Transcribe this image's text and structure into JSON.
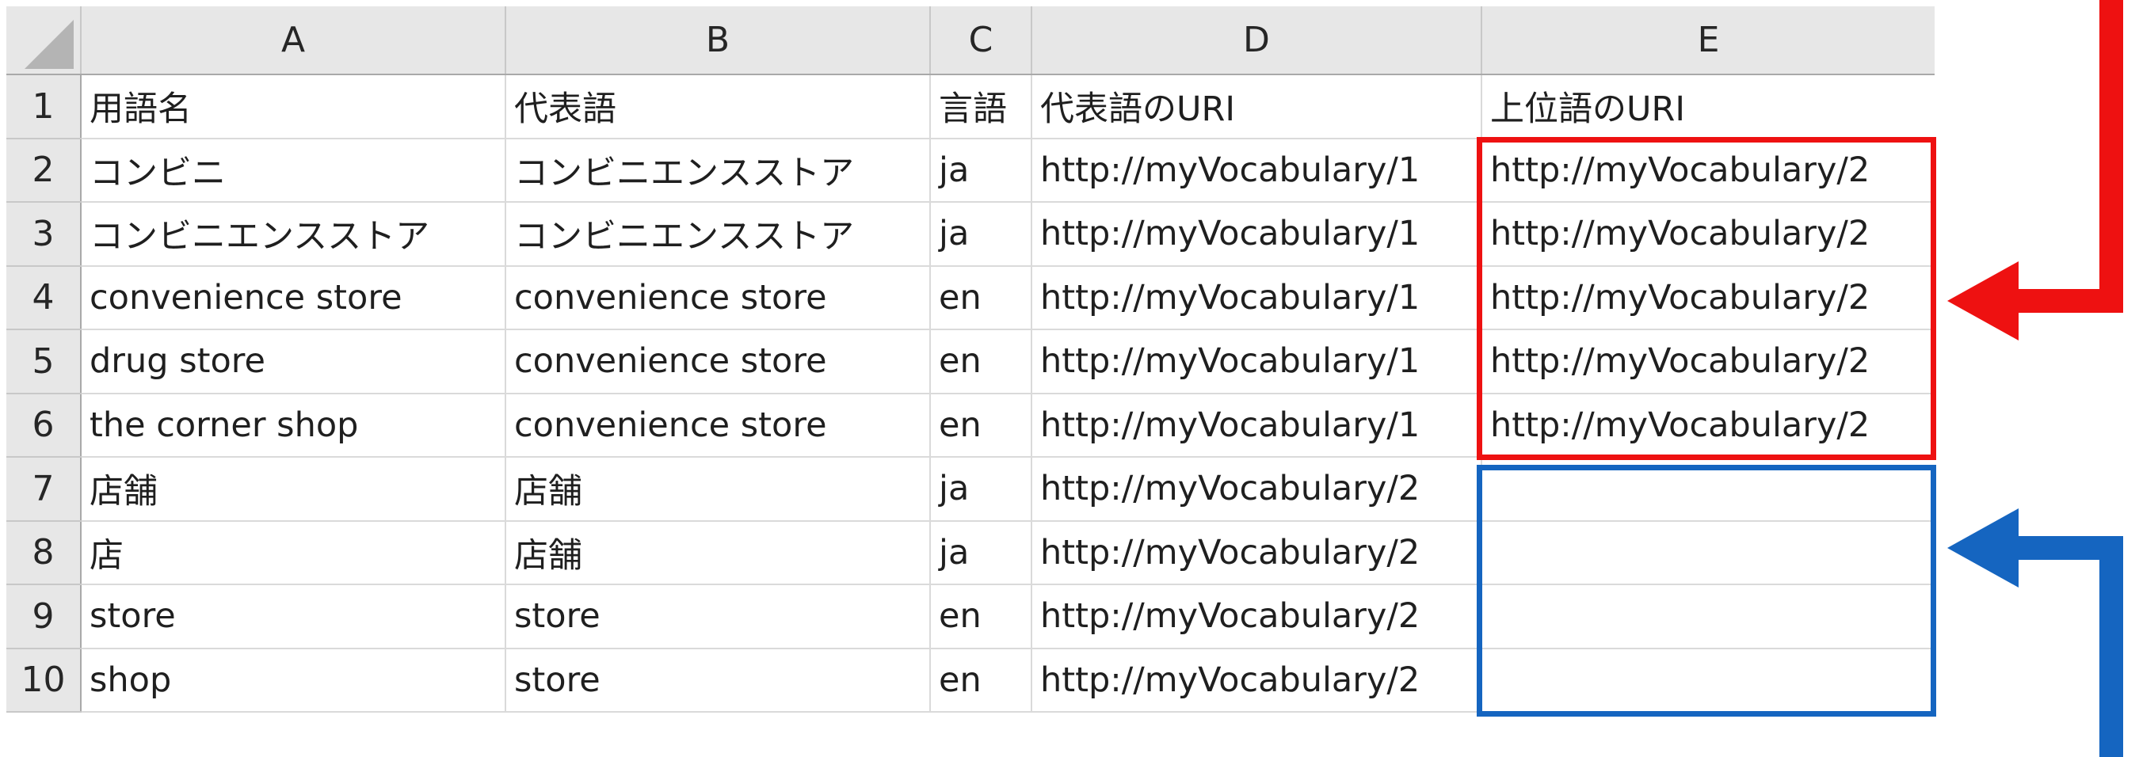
{
  "sheet": {
    "columns": [
      "A",
      "B",
      "C",
      "D",
      "E"
    ],
    "rows": [
      {
        "n": "1",
        "cells": [
          "用語名",
          "代表語",
          "言語",
          "代表語のURI",
          "上位語のURI"
        ]
      },
      {
        "n": "2",
        "cells": [
          "コンビニ",
          "コンビニエンスストア",
          "ja",
          "http://myVocabulary/1",
          "http://myVocabulary/2"
        ]
      },
      {
        "n": "3",
        "cells": [
          "コンビニエンスストア",
          "コンビニエンスストア",
          "ja",
          "http://myVocabulary/1",
          "http://myVocabulary/2"
        ]
      },
      {
        "n": "4",
        "cells": [
          "convenience store",
          "convenience store",
          "en",
          "http://myVocabulary/1",
          "http://myVocabulary/2"
        ]
      },
      {
        "n": "5",
        "cells": [
          "drug store",
          "convenience store",
          "en",
          "http://myVocabulary/1",
          "http://myVocabulary/2"
        ]
      },
      {
        "n": "6",
        "cells": [
          "the corner shop",
          "convenience store",
          "en",
          "http://myVocabulary/1",
          "http://myVocabulary/2"
        ]
      },
      {
        "n": "7",
        "cells": [
          "店舗",
          "店舗",
          "ja",
          "http://myVocabulary/2",
          ""
        ]
      },
      {
        "n": "8",
        "cells": [
          "店",
          "店舗",
          "ja",
          "http://myVocabulary/2",
          ""
        ]
      },
      {
        "n": "9",
        "cells": [
          "store",
          "store",
          "en",
          "http://myVocabulary/2",
          ""
        ]
      },
      {
        "n": "10",
        "cells": [
          "shop",
          "store",
          "en",
          "http://myVocabulary/2",
          ""
        ]
      }
    ]
  },
  "annotations": {
    "red_color": "#ee1111",
    "blue_color": "#1565c0"
  }
}
